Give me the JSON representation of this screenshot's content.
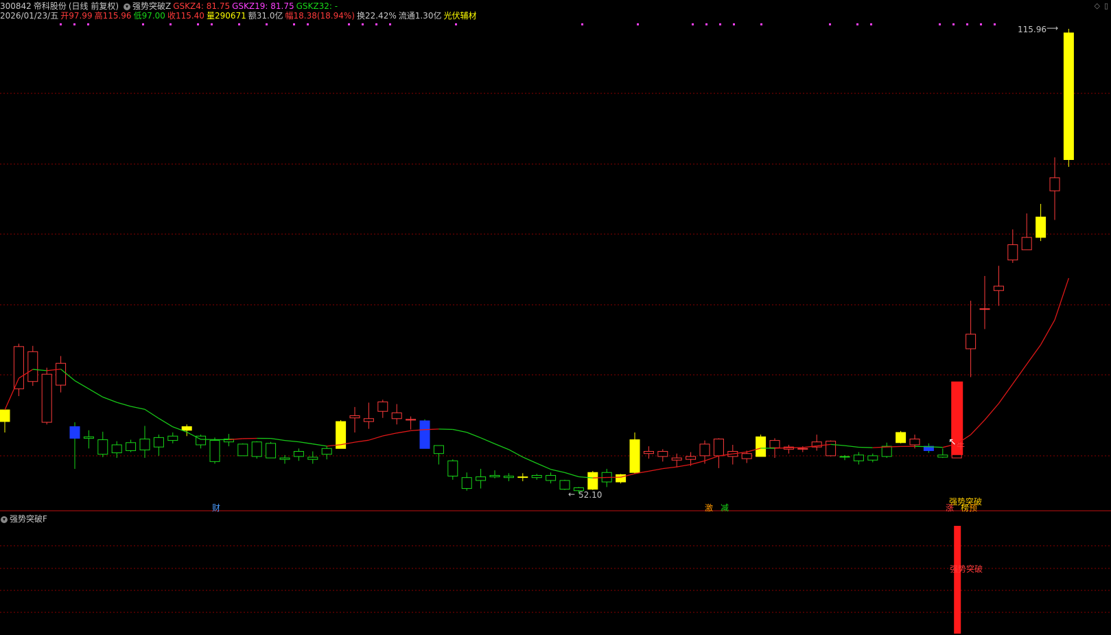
{
  "header": {
    "code": "300842",
    "name": "帝科股份",
    "period": "(日线 前复权)",
    "indicator": "强势突破Z",
    "gskz4": "GSKZ4: 81.75",
    "gskz19": "GSKZ19: 81.75",
    "gskz32": "GSKZ32: -",
    "date": "2026/01/23/五",
    "open": "开97.99",
    "high": "高115.96",
    "low": "低97.00",
    "close": "收115.40",
    "volume": "量290671",
    "amount": "额31.0亿",
    "change": "幅18.38(18.94%)",
    "turnover": "换22.42%",
    "float": "流通1.30亿",
    "sector": "光伏辅材"
  },
  "sub_panel": {
    "title": "强势突破F",
    "signal_label": "强势突破"
  },
  "annotations": {
    "high_label": "115.96",
    "low_label": "52.10",
    "niu": "牛",
    "signal_top": "强势突破",
    "marker_cai": "财",
    "marker_ji": "激",
    "marker_jian": "减",
    "marker_zhang": "涨",
    "marker_bang": "榜",
    "marker_yu": "预"
  },
  "colors": {
    "up": "#ff3b3b",
    "down": "#18d818",
    "yellow": "#ffff00",
    "blue": "#1c3cff",
    "magenta": "#ff40ff",
    "grid": "#8b0000",
    "ma_up": "#e01818",
    "ma_down": "#18c818"
  },
  "chart_data": {
    "type": "candlestick",
    "price_range": [
      52.1,
      115.96
    ],
    "candles": [
      {
        "o": 62,
        "h": 63.6,
        "l": 60.5,
        "c": 63.6,
        "k": "y"
      },
      {
        "o": 66.5,
        "h": 72.7,
        "l": 65.5,
        "c": 72.3,
        "k": "u"
      },
      {
        "o": 67.5,
        "h": 72.4,
        "l": 66.9,
        "c": 71.6,
        "k": "u"
      },
      {
        "o": 61.9,
        "h": 69.4,
        "l": 61.6,
        "c": 68.5,
        "k": "u"
      },
      {
        "o": 67.0,
        "h": 71.0,
        "l": 66.0,
        "c": 70.0,
        "k": "u"
      },
      {
        "o": 61.3,
        "h": 61.9,
        "l": 55.5,
        "c": 59.7,
        "k": "b"
      },
      {
        "o": 59.9,
        "h": 60.8,
        "l": 58.3,
        "c": 59.7,
        "k": "d"
      },
      {
        "o": 59.5,
        "h": 60.6,
        "l": 57.1,
        "c": 57.5,
        "k": "d"
      },
      {
        "o": 57.7,
        "h": 59.3,
        "l": 57.0,
        "c": 58.8,
        "k": "d"
      },
      {
        "o": 58.0,
        "h": 59.5,
        "l": 57.8,
        "c": 59.1,
        "k": "d"
      },
      {
        "o": 58.1,
        "h": 61.4,
        "l": 57.0,
        "c": 59.6,
        "k": "d"
      },
      {
        "o": 58.5,
        "h": 60.2,
        "l": 57.3,
        "c": 59.8,
        "k": "d"
      },
      {
        "o": 59.4,
        "h": 60.5,
        "l": 59.0,
        "c": 60.0,
        "k": "d"
      },
      {
        "o": 60.8,
        "h": 61.6,
        "l": 60.0,
        "c": 61.3,
        "k": "y"
      },
      {
        "o": 58.8,
        "h": 60.2,
        "l": 58.3,
        "c": 60.0,
        "k": "d"
      },
      {
        "o": 56.5,
        "h": 59.8,
        "l": 56.2,
        "c": 59.4,
        "k": "d"
      },
      {
        "o": 59.2,
        "h": 60.3,
        "l": 58.6,
        "c": 59.6,
        "k": "d"
      },
      {
        "o": 57.3,
        "h": 59.0,
        "l": 57.3,
        "c": 58.9,
        "k": "d"
      },
      {
        "o": 57.2,
        "h": 59.3,
        "l": 56.9,
        "c": 59.2,
        "k": "d"
      },
      {
        "o": 57.0,
        "h": 59.2,
        "l": 57.0,
        "c": 59.0,
        "k": "d"
      },
      {
        "o": 57.0,
        "h": 57.4,
        "l": 56.2,
        "c": 56.8,
        "k": "d"
      },
      {
        "o": 57.2,
        "h": 58.3,
        "l": 56.6,
        "c": 57.9,
        "k": "d"
      },
      {
        "o": 56.8,
        "h": 57.9,
        "l": 56.2,
        "c": 57.1,
        "k": "d"
      },
      {
        "o": 57.5,
        "h": 58.6,
        "l": 56.8,
        "c": 58.3,
        "k": "d"
      },
      {
        "o": 58.3,
        "h": 62.2,
        "l": 58.3,
        "c": 62.0,
        "k": "y"
      },
      {
        "o": 62.5,
        "h": 64.0,
        "l": 60.5,
        "c": 62.8,
        "k": "u"
      },
      {
        "o": 62.0,
        "h": 64.6,
        "l": 61.0,
        "c": 62.4,
        "k": "u"
      },
      {
        "o": 63.4,
        "h": 65.0,
        "l": 62.5,
        "c": 64.7,
        "k": "u"
      },
      {
        "o": 62.4,
        "h": 64.4,
        "l": 61.6,
        "c": 63.2,
        "k": "u"
      },
      {
        "o": 62.3,
        "h": 62.7,
        "l": 60.9,
        "c": 62.2,
        "k": "u"
      },
      {
        "o": 62.1,
        "h": 62.3,
        "l": 58.3,
        "c": 58.3,
        "k": "b"
      },
      {
        "o": 57.6,
        "h": 58.6,
        "l": 56.1,
        "c": 58.7,
        "k": "d"
      },
      {
        "o": 54.5,
        "h": 56.8,
        "l": 54.0,
        "c": 56.6,
        "k": "d"
      },
      {
        "o": 52.8,
        "h": 55.0,
        "l": 52.5,
        "c": 54.3,
        "k": "d"
      },
      {
        "o": 53.9,
        "h": 55.5,
        "l": 52.8,
        "c": 54.4,
        "k": "d"
      },
      {
        "o": 54.4,
        "h": 55.3,
        "l": 54.2,
        "c": 54.6,
        "k": "d"
      },
      {
        "o": 54.3,
        "h": 54.9,
        "l": 53.8,
        "c": 54.5,
        "k": "d"
      },
      {
        "o": 54.4,
        "h": 54.9,
        "l": 53.8,
        "c": 54.4,
        "k": "y"
      },
      {
        "o": 54.3,
        "h": 54.8,
        "l": 54.0,
        "c": 54.6,
        "k": "d"
      },
      {
        "o": 54.6,
        "h": 55.0,
        "l": 53.5,
        "c": 53.9,
        "k": "d"
      },
      {
        "o": 52.7,
        "h": 54.0,
        "l": 52.6,
        "c": 53.9,
        "k": "d"
      },
      {
        "o": 52.5,
        "h": 53.0,
        "l": 52.1,
        "c": 52.9,
        "k": "d"
      },
      {
        "o": 52.7,
        "h": 55.2,
        "l": 52.6,
        "c": 55.0,
        "k": "y"
      },
      {
        "o": 53.7,
        "h": 55.5,
        "l": 53.0,
        "c": 55.0,
        "k": "d"
      },
      {
        "o": 53.7,
        "h": 54.8,
        "l": 53.5,
        "c": 54.7,
        "k": "y"
      },
      {
        "o": 55.0,
        "h": 60.5,
        "l": 54.8,
        "c": 59.5,
        "k": "y"
      },
      {
        "o": 57.6,
        "h": 58.6,
        "l": 56.9,
        "c": 57.9,
        "k": "u"
      },
      {
        "o": 57.2,
        "h": 58.2,
        "l": 56.5,
        "c": 57.9,
        "k": "u"
      },
      {
        "o": 56.7,
        "h": 57.6,
        "l": 55.7,
        "c": 57.0,
        "k": "u"
      },
      {
        "o": 56.8,
        "h": 57.8,
        "l": 55.9,
        "c": 57.2,
        "k": "u"
      },
      {
        "o": 57.3,
        "h": 59.4,
        "l": 56.2,
        "c": 58.9,
        "k": "u"
      },
      {
        "o": 57.3,
        "h": 59.7,
        "l": 55.6,
        "c": 59.6,
        "k": "u"
      },
      {
        "o": 57.2,
        "h": 58.8,
        "l": 56.1,
        "c": 57.9,
        "k": "u"
      },
      {
        "o": 56.9,
        "h": 58.0,
        "l": 56.3,
        "c": 57.6,
        "k": "u"
      },
      {
        "o": 57.2,
        "h": 60.2,
        "l": 57.2,
        "c": 59.9,
        "k": "y"
      },
      {
        "o": 58.4,
        "h": 59.7,
        "l": 57.0,
        "c": 59.4,
        "k": "u"
      },
      {
        "o": 58.2,
        "h": 58.8,
        "l": 57.6,
        "c": 58.5,
        "k": "u"
      },
      {
        "o": 58.2,
        "h": 58.6,
        "l": 57.8,
        "c": 58.3,
        "k": "u"
      },
      {
        "o": 58.5,
        "h": 60.2,
        "l": 58.0,
        "c": 59.2,
        "k": "u"
      },
      {
        "o": 57.3,
        "h": 59.4,
        "l": 57.2,
        "c": 59.3,
        "k": "u"
      },
      {
        "o": 57.2,
        "h": 57.4,
        "l": 56.7,
        "c": 57.2,
        "k": "d"
      },
      {
        "o": 56.6,
        "h": 57.8,
        "l": 56.1,
        "c": 57.4,
        "k": "d"
      },
      {
        "o": 56.7,
        "h": 57.6,
        "l": 56.4,
        "c": 57.3,
        "k": "d"
      },
      {
        "o": 57.2,
        "h": 59.1,
        "l": 57.0,
        "c": 58.6,
        "k": "d"
      },
      {
        "o": 59.1,
        "h": 60.7,
        "l": 59.0,
        "c": 60.5,
        "k": "y"
      },
      {
        "o": 58.8,
        "h": 60.2,
        "l": 58.3,
        "c": 59.6,
        "k": "u"
      },
      {
        "o": 58.6,
        "h": 59.0,
        "l": 57.7,
        "c": 58.0,
        "k": "b"
      },
      {
        "o": 57.1,
        "h": 58.3,
        "l": 57.0,
        "c": 57.4,
        "k": "d"
      },
      {
        "o": 57.0,
        "h": 63.9,
        "l": 57.0,
        "c": 63.9,
        "k": "u"
      },
      {
        "o": 74.0,
        "h": 78.6,
        "l": 68.1,
        "c": 72.0,
        "k": "u"
      },
      {
        "o": 77.5,
        "h": 82.0,
        "l": 74.7,
        "c": 77.5,
        "k": "u"
      },
      {
        "o": 80.6,
        "h": 83.4,
        "l": 77.9,
        "c": 80.0,
        "k": "u"
      },
      {
        "o": 86.3,
        "h": 88.4,
        "l": 83.8,
        "c": 84.2,
        "k": "u"
      },
      {
        "o": 87.3,
        "h": 90.6,
        "l": 85.7,
        "c": 85.6,
        "k": "u"
      },
      {
        "o": 90.1,
        "h": 91.9,
        "l": 86.8,
        "c": 87.3,
        "k": "y"
      },
      {
        "o": 95.5,
        "h": 98.3,
        "l": 89.7,
        "c": 93.7,
        "k": "u"
      },
      {
        "o": 97.99,
        "h": 115.96,
        "l": 97.0,
        "c": 115.4,
        "k": "y"
      }
    ]
  }
}
